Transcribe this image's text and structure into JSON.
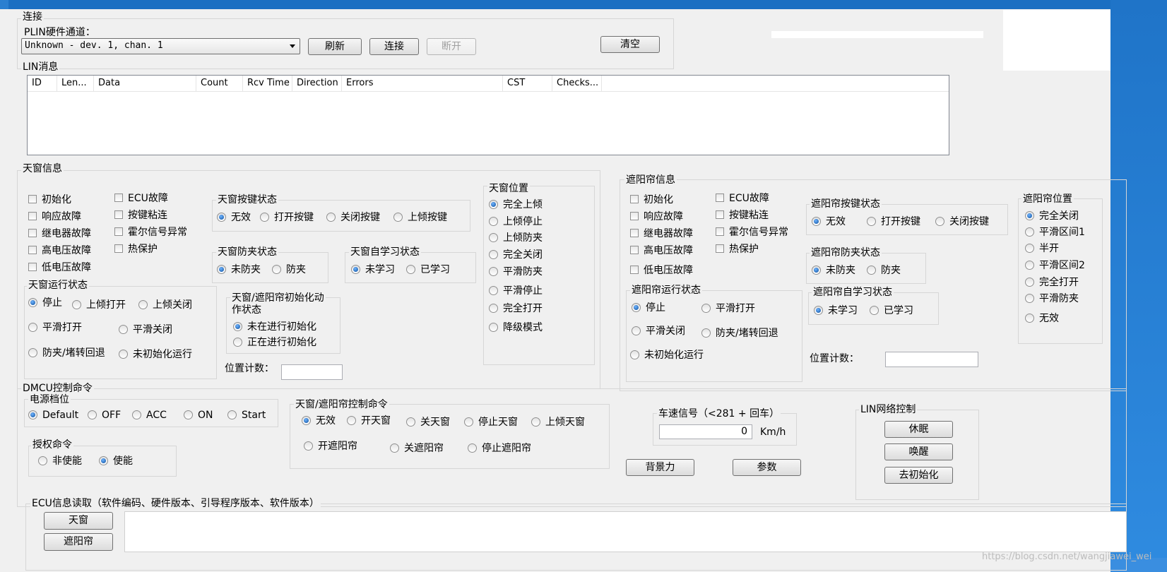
{
  "connect": {
    "title": "连接",
    "channel_label": "PLIN硬件通道：",
    "channel_value": "Unknown - dev. 1, chan. 1",
    "refresh": "刷新",
    "connect": "连接",
    "disconnect": "断开",
    "clear": "清空"
  },
  "lin": {
    "title": "LIN消息",
    "columns": [
      "ID",
      "Len...",
      "Data",
      "Count",
      "Rcv Time",
      "Direction",
      "Errors",
      "CST",
      "Checks..."
    ]
  },
  "sunroof_info": {
    "title": "天窗信息",
    "faults_col1": [
      "初始化",
      "响应故障",
      "继电器故障",
      "高电压故障",
      "低电压故障"
    ],
    "faults_col2": [
      "ECU故障",
      "按键粘连",
      "霍尔信号异常",
      "热保护"
    ],
    "key_state": {
      "title": "天窗按键状态",
      "options": [
        "无效",
        "打开按键",
        "关闭按键",
        "上倾按键"
      ],
      "selected": "无效"
    },
    "pinch_state": {
      "title": "天窗防夹状态",
      "options": [
        "未防夹",
        "防夹"
      ],
      "selected": "未防夹"
    },
    "learn_state": {
      "title": "天窗自学习状态",
      "options": [
        "未学习",
        "已学习"
      ],
      "selected": "未学习"
    },
    "position": {
      "title": "天窗位置",
      "options": [
        "完全上倾",
        "上倾停止",
        "上倾防夹",
        "完全关闭",
        "平滑防夹",
        "平滑停止",
        "完全打开",
        "降级模式"
      ],
      "selected": "完全上倾"
    },
    "run_state": {
      "title": "天窗运行状态",
      "options": [
        "停止",
        "上倾打开",
        "上倾关闭",
        "平滑打开",
        "平滑关闭",
        "防夹/堵转回退",
        "未初始化运行"
      ],
      "selected": "停止"
    },
    "init_state": {
      "title_line1": "天窗/遮阳帘初始化动",
      "title_line2": "作状态",
      "options": [
        "未在进行初始化",
        "正在进行初始化"
      ],
      "selected": "未在进行初始化"
    },
    "pos_count_label": "位置计数："
  },
  "shade_info": {
    "title": "遮阳帘信息",
    "faults_col1": [
      "初始化",
      "响应故障",
      "继电器故障",
      "高电压故障",
      "低电压故障"
    ],
    "faults_col2": [
      "ECU故障",
      "按键粘连",
      "霍尔信号异常",
      "热保护"
    ],
    "key_state": {
      "title": "遮阳帘按键状态",
      "options": [
        "无效",
        "打开按键",
        "关闭按键"
      ],
      "selected": "无效"
    },
    "pinch_state": {
      "title": "遮阳帘防夹状态",
      "options": [
        "未防夹",
        "防夹"
      ],
      "selected": "未防夹"
    },
    "learn_state": {
      "title": "遮阳帘自学习状态",
      "options": [
        "未学习",
        "已学习"
      ],
      "selected": "未学习"
    },
    "run_state": {
      "title": "遮阳帘运行状态",
      "options": [
        "停止",
        "平滑打开",
        "平滑关闭",
        "防夹/堵转回退",
        "未初始化运行"
      ],
      "selected": "停止"
    },
    "position": {
      "title": "遮阳帘位置",
      "options": [
        "完全关闭",
        "平滑区间1",
        "半开",
        "平滑区间2",
        "完全打开",
        "平滑防夹",
        "无效"
      ],
      "selected": "完全关闭"
    },
    "pos_count_label": "位置计数："
  },
  "dmcu": {
    "title": "DMCU控制命令",
    "power": {
      "title": "电源档位",
      "options": [
        "Default",
        "OFF",
        "ACC",
        "ON",
        "Start"
      ],
      "selected": "Default"
    },
    "auth": {
      "title": "授权命令",
      "options": [
        "非使能",
        "使能"
      ],
      "selected": "使能"
    },
    "ctrl": {
      "title": "天窗/遮阳帘控制命令",
      "options": [
        "无效",
        "开天窗",
        "关天窗",
        "停止天窗",
        "上倾天窗",
        "开遮阳帘",
        "关遮阳帘",
        "停止遮阳帘"
      ],
      "selected": "无效"
    },
    "speed": {
      "title": "车速信号（<281 + 回车）",
      "value": "0",
      "unit": "Km/h"
    },
    "backlight": "背景力",
    "params": "参数",
    "lin_net": {
      "title": "LIN网络控制",
      "sleep": "休眠",
      "wake": "唤醒",
      "deinit": "去初始化"
    }
  },
  "ecu": {
    "title": "ECU信息读取（软件编码、硬件版本、引导程序版本、软件版本）",
    "sunroof": "天窗",
    "shade": "遮阳帘"
  },
  "watermark": "https://blog.csdn.net/wangjiawei_wei"
}
